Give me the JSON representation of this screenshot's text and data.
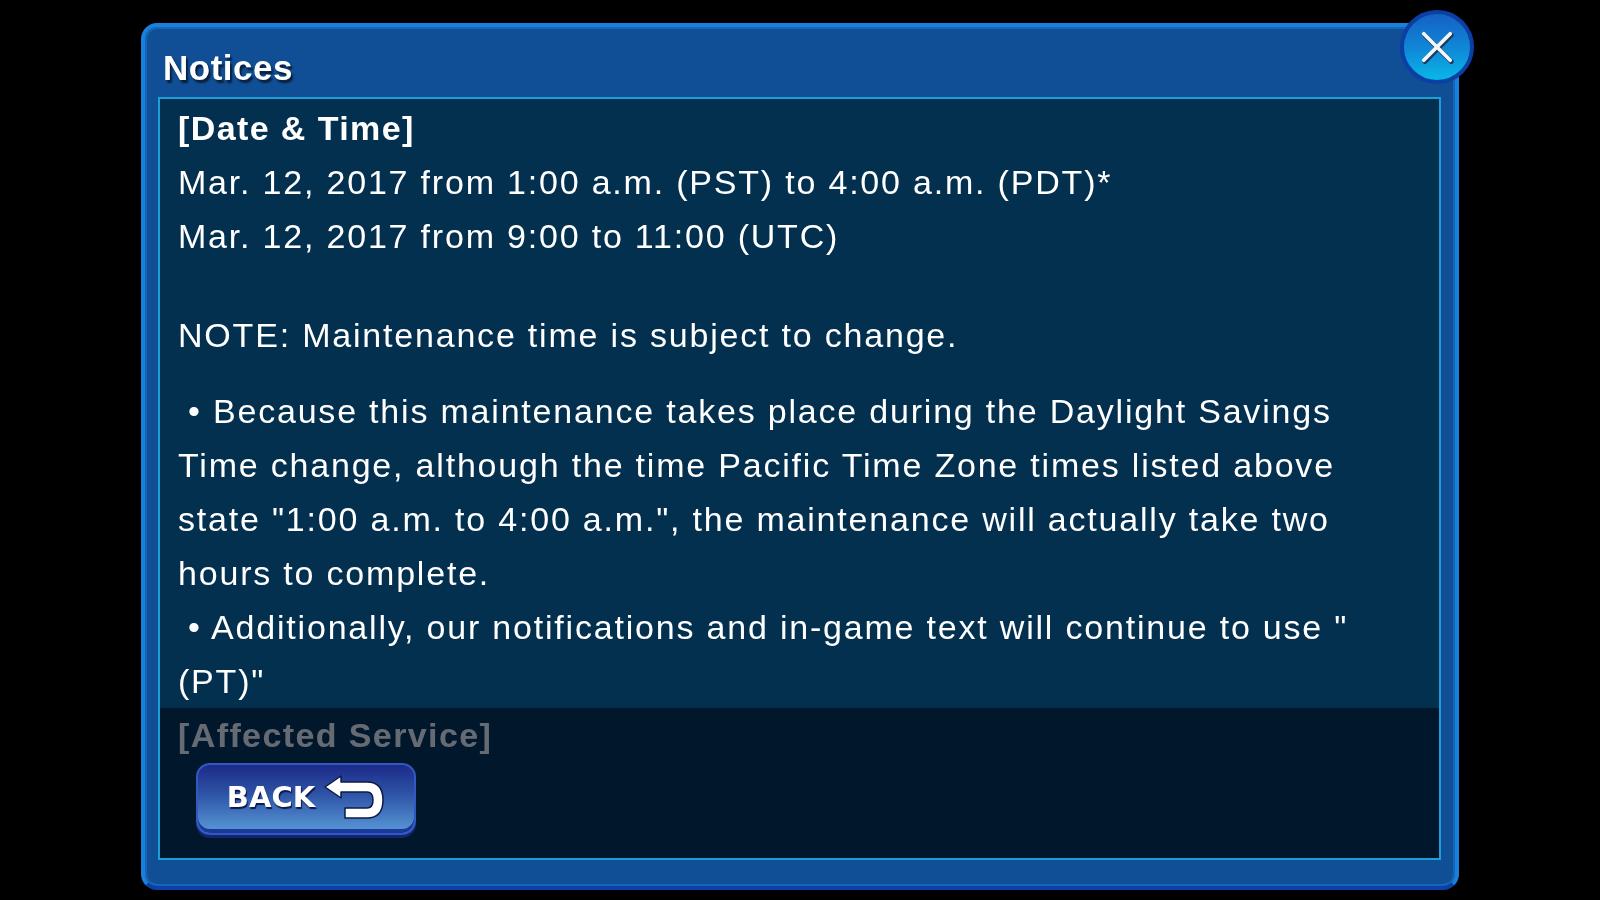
{
  "dialog": {
    "title": "Notices",
    "body": [
      {
        "kind": "heading",
        "text": "[Date & Time]"
      },
      {
        "kind": "line",
        "text": "Mar. 12, 2017 from 1:00 a.m. (PST) to 4:00 a.m. (PDT)*"
      },
      {
        "kind": "line",
        "text": "Mar. 12, 2017 from 9:00 to 11:00 (UTC)"
      },
      {
        "kind": "note",
        "text": "NOTE: Maintenance time is subject to change."
      },
      {
        "kind": "bullet",
        "text": "• Because this maintenance takes place during the Daylight Savings Time change, although the time Pacific Time Zone times listed above state \"1:00 a.m. to 4:00 a.m.\", the maintenance will actually take two hours to complete."
      },
      {
        "kind": "bullet",
        "text": "• Additionally, our notifications and in-game text will continue to use \" (PT)\""
      },
      {
        "kind": "heading",
        "text": "[Affected Service]"
      }
    ],
    "back_button": {
      "label": "BACK"
    }
  }
}
